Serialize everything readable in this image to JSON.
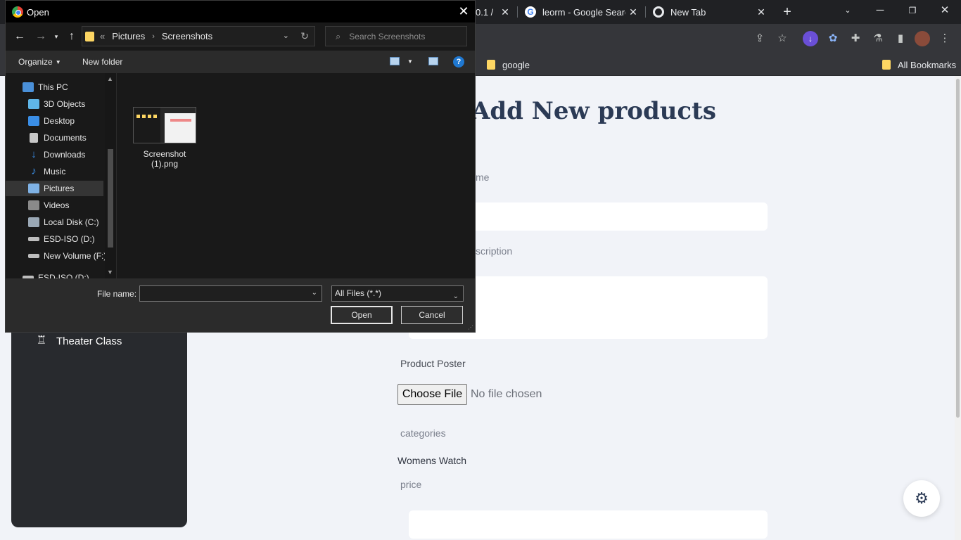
{
  "browser": {
    "tabs": [
      {
        "title": "0.1 /",
        "icon": "page-icon"
      },
      {
        "title": "leorm - Google Searc",
        "icon": "google-icon"
      },
      {
        "title": "New Tab",
        "icon": "chrome-icon"
      }
    ],
    "bookmarks": [
      {
        "label": "google"
      },
      {
        "label": "All Bookmarks"
      }
    ]
  },
  "page": {
    "title": "Add New products",
    "name_label": "me",
    "description_label": "scription",
    "poster_label": "Product Poster",
    "choose_file": "Choose File",
    "no_file": "No file chosen",
    "categories_label": "categories",
    "category_value": "Womens Watch",
    "price_label": "price",
    "sidebar_item": "Theater Class"
  },
  "dialog": {
    "title": "Open",
    "path": [
      "Pictures",
      "Screenshots"
    ],
    "path_overflow": "«",
    "search_placeholder": "Search Screenshots",
    "organize": "Organize",
    "new_folder": "New folder",
    "help": "?",
    "nav_items": [
      {
        "label": "This PC",
        "icon": "pc-icon",
        "color": "#4a90d9"
      },
      {
        "label": "3D Objects",
        "icon": "cube-icon",
        "color": "#5fb6e8"
      },
      {
        "label": "Desktop",
        "icon": "desktop-icon",
        "color": "#3a8ee6"
      },
      {
        "label": "Documents",
        "icon": "documents-icon",
        "color": "#c8c8c8"
      },
      {
        "label": "Downloads",
        "icon": "downloads-icon",
        "color": "#3a8ee6"
      },
      {
        "label": "Music",
        "icon": "music-icon",
        "color": "#3a8ee6"
      },
      {
        "label": "Pictures",
        "icon": "pictures-icon",
        "color": "#7fb2e5"
      },
      {
        "label": "Videos",
        "icon": "videos-icon",
        "color": "#8a8a8a"
      },
      {
        "label": "Local Disk (C:)",
        "icon": "disk-icon",
        "color": "#9aa8b5"
      },
      {
        "label": "ESD-ISO (D:)",
        "icon": "drive-icon",
        "color": "#bdbdbd"
      },
      {
        "label": "New Volume (F:)",
        "icon": "drive-icon",
        "color": "#bdbdbd"
      },
      {
        "label": "ESD-ISO (D:)",
        "icon": "drive-icon",
        "color": "#bdbdbd"
      }
    ],
    "selected_nav": "Pictures",
    "files": [
      {
        "name": "Screenshot (1).png",
        "name_line1": "Screenshot",
        "name_line2": "(1).png"
      }
    ],
    "file_name_label": "File name:",
    "file_name_value": "",
    "filter": "All Files (*.*)",
    "open_button": "Open",
    "cancel_button": "Cancel"
  },
  "colors": {
    "page_bg": "#f1f3f8",
    "title_color": "#2b3a55",
    "dialog_bg": "#191919",
    "folder_yellow": "#fdd663"
  }
}
